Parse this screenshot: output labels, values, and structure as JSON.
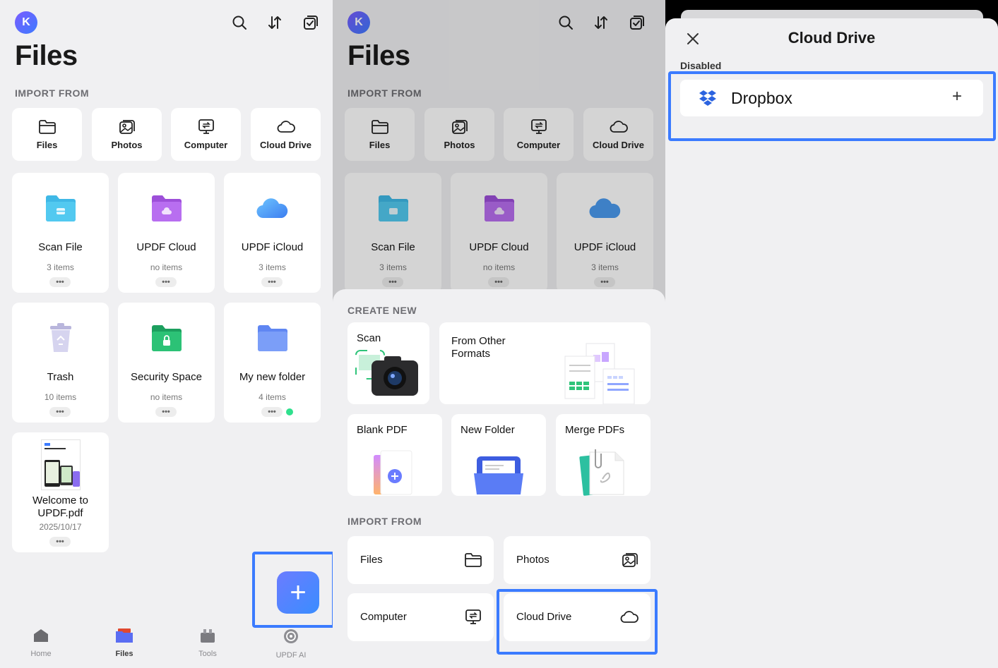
{
  "files_screen": {
    "avatar_initial": "K",
    "title": "Files",
    "import_section": "IMPORT FROM",
    "import_items": [
      {
        "label": "Files",
        "icon": "folder-icon"
      },
      {
        "label": "Photos",
        "icon": "photos-icon"
      },
      {
        "label": "Computer",
        "icon": "computer-icon"
      },
      {
        "label": "Cloud Drive",
        "icon": "cloud-icon"
      }
    ],
    "folders": [
      {
        "name": "Scan File",
        "count": "3 items",
        "icon": "scan-folder-icon",
        "color": "#3fb8e6"
      },
      {
        "name": "UPDF Cloud",
        "count": "no items",
        "icon": "updf-cloud-folder-icon",
        "color": "#b35ee8"
      },
      {
        "name": "UPDF iCloud",
        "count": "3 items",
        "icon": "icloud-icon",
        "color": "#4b9bef"
      },
      {
        "name": "Trash",
        "count": "10 items",
        "icon": "trash-icon",
        "color": "#c9c7e6"
      },
      {
        "name": "Security Space",
        "count": "no items",
        "icon": "lock-folder-icon",
        "color": "#23b36c"
      },
      {
        "name": "My new folder",
        "count": "4 items",
        "icon": "folder-icon",
        "color": "#6a8ff7"
      },
      {
        "name": "Welcome to UPDF.pdf",
        "count": "2025/10/17",
        "icon": "pdf-thumbnail-icon",
        "color": "#ffffff"
      }
    ],
    "more_glyph": "•••",
    "fab_glyph": "+",
    "tabbar": [
      {
        "label": "Home",
        "icon": "home-icon"
      },
      {
        "label": "Files",
        "icon": "files-tab-icon"
      },
      {
        "label": "Tools",
        "icon": "tools-icon"
      },
      {
        "label": "UPDF AI",
        "icon": "ai-icon"
      }
    ]
  },
  "create_sheet": {
    "create_section": "CREATE NEW",
    "create_items": [
      "Scan",
      "From Other Formats",
      "Blank PDF",
      "New Folder",
      "Merge PDFs"
    ],
    "import_section": "IMPORT FROM",
    "import_items": [
      {
        "label": "Files",
        "icon": "folder-icon"
      },
      {
        "label": "Photos",
        "icon": "photos-icon"
      },
      {
        "label": "Computer",
        "icon": "computer-icon"
      },
      {
        "label": "Cloud Drive",
        "icon": "cloud-icon"
      }
    ]
  },
  "cloud_drive": {
    "title": "Cloud Drive",
    "section": "Disabled",
    "service": "Dropbox",
    "add_glyph": "+"
  },
  "colors": {
    "accent": "#3b7bff",
    "highlight_border": "#3b7bff",
    "background": "#f0f0f2"
  }
}
